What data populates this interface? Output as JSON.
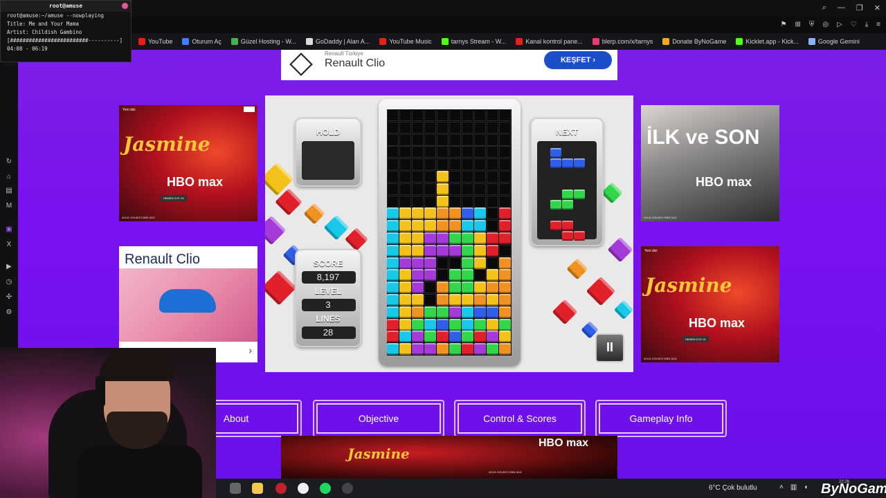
{
  "terminal": {
    "title": "root@amuse",
    "lines": [
      "root@amuse:~/amuse --nowplaying",
      "Title: Me and Your Mama",
      "Artist: Childish Gambino",
      "[#########################----------]",
      "04:08 - 06:19"
    ]
  },
  "bookmarks": [
    {
      "label": "YouTube",
      "icon": "youtube-icon",
      "color": "#e62117"
    },
    {
      "label": "Oturum Aç",
      "icon": "globe-icon",
      "color": "#3b82f6"
    },
    {
      "label": "Güzel Hosting - W...",
      "icon": "gear-icon",
      "color": "#4caf50"
    },
    {
      "label": "GoDaddy | Alan A...",
      "icon": "page-icon",
      "color": "#dddddd"
    },
    {
      "label": "YouTube Music",
      "icon": "youtube-music-icon",
      "color": "#e62117"
    },
    {
      "label": "tarnys Stream - W...",
      "icon": "kick-icon",
      "color": "#53fc18"
    },
    {
      "label": "Kanal kontrol pane...",
      "icon": "youtube-icon",
      "color": "#e62117"
    },
    {
      "label": "blerp.com/x/tarnys",
      "icon": "blerp-icon",
      "color": "#e4406f"
    },
    {
      "label": "Donate ByNoGame",
      "icon": "bynogame-icon",
      "color": "#f5a623"
    },
    {
      "label": "Kicklet.app - Kick...",
      "icon": "kicklet-icon",
      "color": "#53fc18"
    },
    {
      "label": "Google Gemini",
      "icon": "gemini-icon",
      "color": "#8ab4f8"
    }
  ],
  "ad_top": {
    "brand": "Renault Türkiye",
    "title": "Renault Clio",
    "cta": "KEŞFET  ›"
  },
  "ad_left_bottom": {
    "title": "Renault Clio"
  },
  "ad_jasmine": {
    "tag": "Yeni dizi",
    "title": "Jasmine",
    "line": "BAZI YASEMİNLER GECE AÇAR",
    "logo": "HBO max",
    "button": "HEMEN ÜYE OL",
    "price": "AYLIK 229,90TL'DEN İZLE",
    "fine": "Abonelik gerekir. Plan, sonraki fatura tarihinden itibaren geçerli olacak şekilde değişecektir. Ücret uygulama mağazası bazlı değişir. Hüküm ve Koşullar geçerli. 18+"
  },
  "ad_ilk": {
    "title": "İLK ve SON",
    "line": "İLKLERİ UNUTULMAZ, SONLARI KAÇINILMAZDIR",
    "logo": "HBO max",
    "button": "HEMEN ÜYE OL",
    "price": "AYLIK 229,90TL'DEN İZLE"
  },
  "game": {
    "hold_label": "HOLD",
    "next_label": "NEXT",
    "score_label": "SCORE",
    "score": "8,197",
    "level_label": "LEVEL",
    "level": "3",
    "lines_label": "LINES",
    "lines": "28",
    "pause_label": "II"
  },
  "nav": {
    "about": "About",
    "objective": "Objective",
    "controls": "Control & Scores",
    "gameplay": "Gameplay Info"
  },
  "taskbar": {
    "weather": "6°C  Çok bulutlu",
    "clock": "22:26"
  },
  "watermark": "ByNoGame",
  "colors": {
    "page_bg": "#7a12f0",
    "cyan": "#19c8e8",
    "yellow": "#f2c21a",
    "purple": "#a43ad8",
    "green": "#33d64a",
    "red": "#e0202a",
    "orange": "#f09222",
    "blue": "#2f5ee8"
  }
}
